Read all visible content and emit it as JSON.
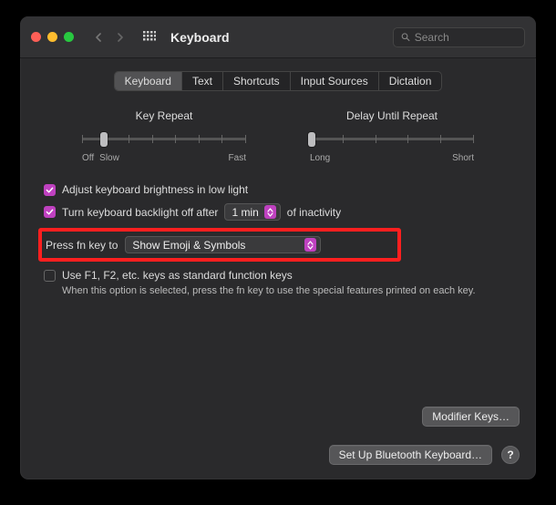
{
  "window": {
    "title": "Keyboard"
  },
  "search": {
    "placeholder": "Search"
  },
  "tabs": [
    "Keyboard",
    "Text",
    "Shortcuts",
    "Input Sources",
    "Dictation"
  ],
  "activeTab": 0,
  "sliders": {
    "keyRepeat": {
      "title": "Key Repeat",
      "leftLabelA": "Off",
      "leftLabelB": "Slow",
      "rightLabel": "Fast"
    },
    "delay": {
      "title": "Delay Until Repeat",
      "leftLabel": "Long",
      "rightLabel": "Short"
    }
  },
  "options": {
    "brightness": "Adjust keyboard brightness in low light",
    "backlight": {
      "pre": "Turn keyboard backlight off after",
      "value": "1 min",
      "post": "of inactivity"
    },
    "fnkey": {
      "pre": "Press fn key to",
      "value": "Show Emoji & Symbols"
    },
    "fkeys": {
      "label": "Use F1, F2, etc. keys as standard function keys",
      "note": "When this option is selected, press the fn key to use the special features printed on each key."
    }
  },
  "buttons": {
    "modifier": "Modifier Keys…",
    "bluetooth": "Set Up Bluetooth Keyboard…",
    "help": "?"
  }
}
